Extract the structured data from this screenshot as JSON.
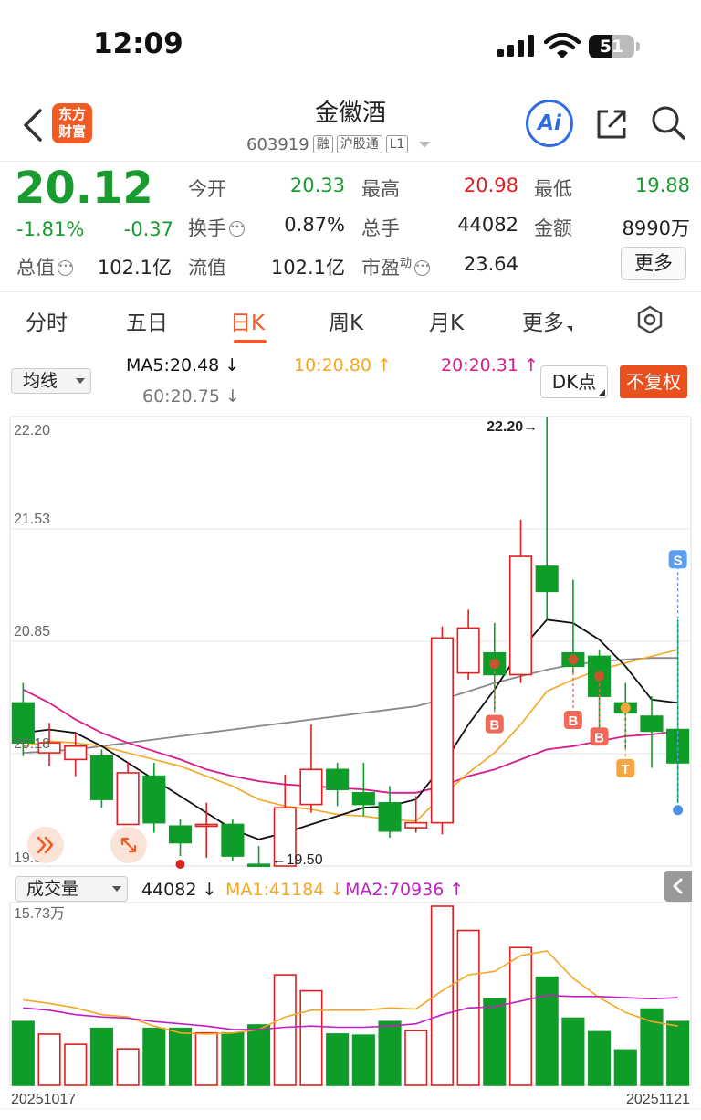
{
  "status_bar": {
    "time": "12:09",
    "battery": "51"
  },
  "header": {
    "stock_name": "金徽酒",
    "stock_code": "603919",
    "tags": [
      "融",
      "沪股通",
      "L1"
    ],
    "logo_text": [
      "东方",
      "财富"
    ],
    "ai_label": "Ai"
  },
  "quote": {
    "price": "20.12",
    "change_pct": "-1.81%",
    "change": "-0.37",
    "fields": [
      {
        "label": "今开",
        "value": "20.33",
        "tone": "dn"
      },
      {
        "label": "最高",
        "value": "20.98",
        "tone": "up"
      },
      {
        "label": "最低",
        "value": "19.88",
        "tone": "dn"
      },
      {
        "label": "换手",
        "value": "0.87%",
        "tone": ""
      },
      {
        "label": "总手",
        "value": "44082",
        "tone": ""
      },
      {
        "label": "金额",
        "value": "8990万",
        "tone": ""
      },
      {
        "label": "总值",
        "value": "102.1亿",
        "tone": ""
      },
      {
        "label": "流值",
        "value": "102.1亿",
        "tone": ""
      },
      {
        "label": "市盈",
        "value": "23.64",
        "tone": ""
      }
    ],
    "pe_superscript": "动",
    "more_label": "更多"
  },
  "tabs": [
    {
      "label": "分时"
    },
    {
      "label": "五日"
    },
    {
      "label": "日K"
    },
    {
      "label": "周K"
    },
    {
      "label": "月K"
    },
    {
      "label": "更多"
    }
  ],
  "active_tab": "日K",
  "ma": {
    "selector": "均线",
    "ma5": "MA5:20.48",
    "ma10": "10:20.80",
    "ma20": "20:20.31",
    "ma60": "60:20.75",
    "dk_label": "DK点",
    "fq_label": "不复权",
    "colors": {
      "ma5": "#111111",
      "ma10": "#f5a623",
      "ma20": "#d81b8c",
      "ma60": "#888888"
    }
  },
  "volume_header": {
    "selector": "成交量",
    "vol": "44082",
    "ma1": "MA1:41184",
    "ma2": "MA2:70936",
    "colors": {
      "ma1": "#f5a623",
      "ma2": "#c020c0"
    }
  },
  "chart_data": {
    "type": "candlestick",
    "y_labels": [
      "22.20",
      "21.53",
      "20.85",
      "20.18",
      "19.50"
    ],
    "ylim": [
      19.5,
      22.2
    ],
    "high_annotation": "22.20",
    "low_annotation": "19.50",
    "vol_max_label": "15.73万",
    "x_start": "20251017",
    "x_end": "20251121",
    "candles": [
      {
        "o": 20.48,
        "c": 20.24,
        "h": 20.6,
        "l": 20.16
      },
      {
        "o": 20.18,
        "c": 20.24,
        "h": 20.36,
        "l": 20.1
      },
      {
        "o": 20.14,
        "c": 20.22,
        "h": 20.3,
        "l": 20.04
      },
      {
        "o": 20.16,
        "c": 19.9,
        "h": 20.2,
        "l": 19.85
      },
      {
        "o": 19.75,
        "c": 20.06,
        "h": 20.12,
        "l": 19.75
      },
      {
        "o": 20.04,
        "c": 19.76,
        "h": 20.12,
        "l": 19.7
      },
      {
        "o": 19.74,
        "c": 19.64,
        "h": 19.78,
        "l": 19.56
      },
      {
        "o": 19.74,
        "c": 19.75,
        "h": 19.88,
        "l": 19.55
      },
      {
        "o": 19.75,
        "c": 19.56,
        "h": 19.78,
        "l": 19.53
      },
      {
        "o": 19.51,
        "c": 19.5,
        "h": 19.62,
        "l": 19.5
      },
      {
        "o": 19.5,
        "c": 19.85,
        "h": 20.05,
        "l": 19.5
      },
      {
        "o": 19.87,
        "c": 20.08,
        "h": 20.35,
        "l": 19.82
      },
      {
        "o": 20.08,
        "c": 19.96,
        "h": 20.12,
        "l": 19.86
      },
      {
        "o": 19.94,
        "c": 19.87,
        "h": 20.12,
        "l": 19.8
      },
      {
        "o": 19.88,
        "c": 19.71,
        "h": 19.98,
        "l": 19.67
      },
      {
        "o": 19.73,
        "c": 19.76,
        "h": 19.92,
        "l": 19.7
      },
      {
        "o": 19.76,
        "c": 20.87,
        "h": 20.94,
        "l": 19.69
      },
      {
        "o": 20.66,
        "c": 20.93,
        "h": 21.04,
        "l": 20.62
      },
      {
        "o": 20.78,
        "c": 20.65,
        "h": 20.96,
        "l": 20.44
      },
      {
        "o": 20.65,
        "c": 21.36,
        "h": 21.58,
        "l": 20.6
      },
      {
        "o": 21.3,
        "c": 21.15,
        "h": 22.2,
        "l": 20.98
      },
      {
        "o": 20.78,
        "c": 20.7,
        "h": 21.22,
        "l": 20.66
      },
      {
        "o": 20.76,
        "c": 20.52,
        "h": 20.8,
        "l": 20.31
      },
      {
        "o": 20.48,
        "c": 20.42,
        "h": 20.6,
        "l": 20.2
      },
      {
        "o": 20.4,
        "c": 20.31,
        "h": 20.52,
        "l": 20.09
      },
      {
        "o": 20.32,
        "c": 20.12,
        "h": 20.98,
        "l": 19.88
      }
    ],
    "ma5": [
      20.3,
      20.32,
      20.3,
      20.22,
      20.12,
      20.02,
      19.92,
      19.82,
      19.72,
      19.66,
      19.7,
      19.75,
      19.8,
      19.85,
      19.86,
      19.9,
      20.1,
      20.35,
      20.56,
      20.8,
      20.98,
      20.96,
      20.86,
      20.7,
      20.5,
      20.48
    ],
    "ma10": [
      20.22,
      20.25,
      20.24,
      20.22,
      20.18,
      20.14,
      20.1,
      20.04,
      19.98,
      19.9,
      19.86,
      19.84,
      19.81,
      19.8,
      19.78,
      19.77,
      19.92,
      20.06,
      20.18,
      20.35,
      20.55,
      20.62,
      20.68,
      20.72,
      20.76,
      20.8
    ],
    "ma20": [
      20.56,
      20.48,
      20.38,
      20.3,
      20.24,
      20.19,
      20.14,
      20.08,
      20.04,
      20.01,
      19.99,
      19.98,
      19.97,
      19.96,
      19.94,
      19.94,
      19.98,
      20.04,
      20.08,
      20.14,
      20.2,
      20.22,
      20.25,
      20.28,
      20.29,
      20.31
    ],
    "ma60": [
      20.18,
      20.19,
      20.2,
      20.22,
      20.24,
      20.26,
      20.28,
      20.3,
      20.32,
      20.34,
      20.36,
      20.38,
      20.4,
      20.42,
      20.44,
      20.46,
      20.5,
      20.55,
      20.6,
      20.64,
      20.68,
      20.71,
      20.73,
      20.74,
      20.75,
      20.75
    ],
    "volume": [
      5.6,
      4.5,
      3.6,
      5.0,
      3.2,
      5.0,
      5.0,
      4.6,
      4.6,
      5.3,
      9.7,
      8.3,
      4.5,
      4.4,
      5.6,
      4.8,
      15.73,
      13.6,
      7.6,
      12.1,
      9.5,
      5.9,
      4.7,
      3.1,
      6.7,
      5.6
    ],
    "vol_ma1": [
      7.5,
      7.2,
      6.8,
      6.2,
      6.0,
      5.2,
      4.6,
      4.5,
      4.6,
      4.9,
      6.0,
      6.6,
      6.6,
      6.6,
      6.8,
      6.7,
      8.3,
      9.7,
      10.0,
      11.4,
      11.8,
      9.4,
      7.7,
      6.4,
      5.6,
      5.2
    ],
    "vol_ma2": [
      6.8,
      6.6,
      6.2,
      6.0,
      5.9,
      5.6,
      5.4,
      5.2,
      4.9,
      4.9,
      5.1,
      5.2,
      5.1,
      5.1,
      5.2,
      5.4,
      6.2,
      6.8,
      6.9,
      7.4,
      7.9,
      7.8,
      7.8,
      7.7,
      7.6,
      7.7
    ],
    "signals": [
      {
        "i": 20,
        "type": "S",
        "pos": "top"
      },
      {
        "i": 25,
        "type": "S",
        "pos": "top"
      },
      {
        "i": 18,
        "type": "B",
        "pos": "bottom"
      },
      {
        "i": 21,
        "type": "B",
        "pos": "bottom"
      },
      {
        "i": 22,
        "type": "B",
        "pos": "bottom"
      },
      {
        "i": 23,
        "type": "T",
        "pos": "bottom"
      }
    ],
    "colors": {
      "up": "#e02020",
      "down": "#0f9d2a",
      "s_tag": "#5b9df5",
      "b_tag": "#f06a5a",
      "t_tag": "#f7a540"
    }
  }
}
